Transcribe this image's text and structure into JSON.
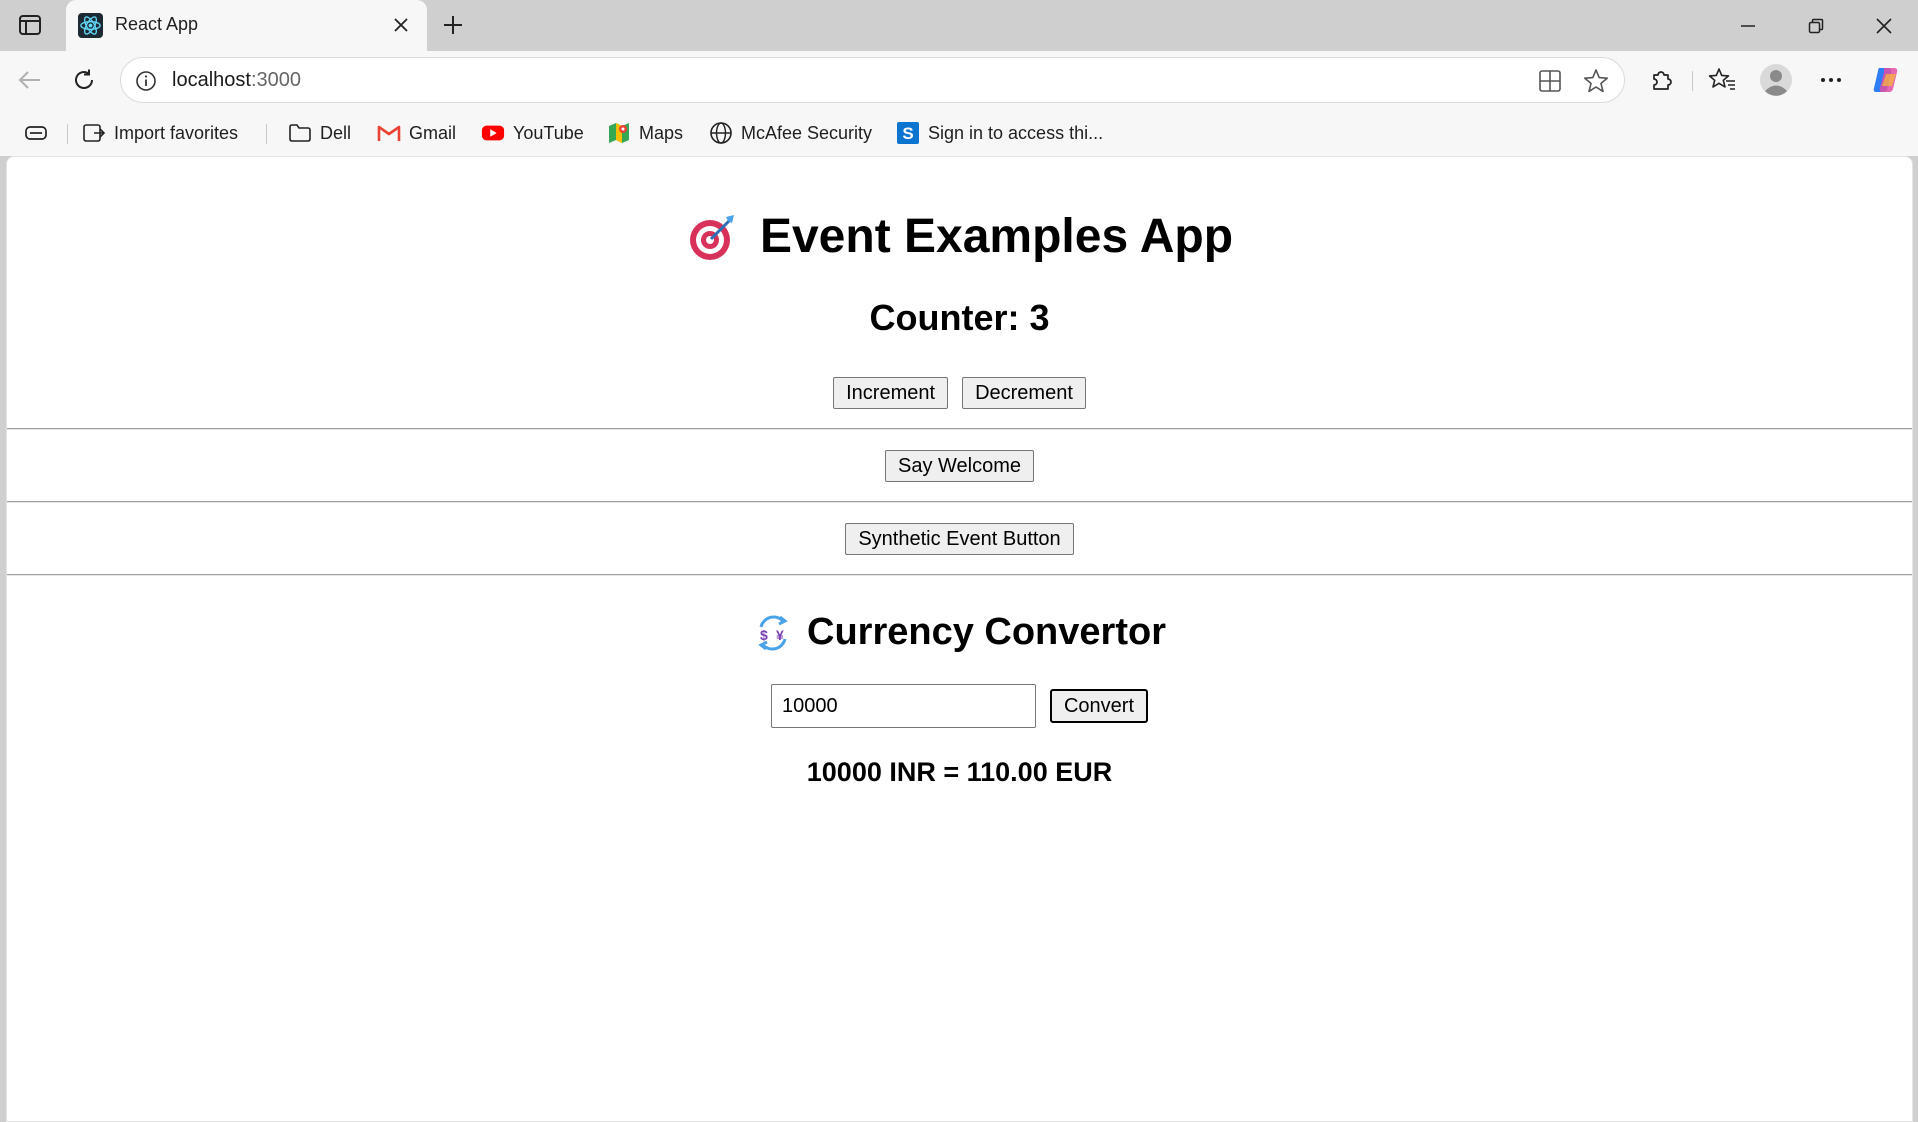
{
  "browser": {
    "tab": {
      "title": "React App"
    },
    "address": {
      "host": "localhost",
      "port": ":3000"
    },
    "favorites": [
      {
        "label": "Import favorites",
        "icon": "import-icon"
      },
      {
        "label": "Dell",
        "icon": "folder-icon"
      },
      {
        "label": "Gmail",
        "icon": "gmail-icon"
      },
      {
        "label": "YouTube",
        "icon": "youtube-icon"
      },
      {
        "label": "Maps",
        "icon": "maps-icon"
      },
      {
        "label": "McAfee Security",
        "icon": "globe-icon"
      },
      {
        "label": "Sign in to access thi...",
        "icon": "s-icon"
      }
    ],
    "colors": {
      "youtube": "#ff0000",
      "s_badge": "#0a74d0",
      "gmail": "#ea4335"
    }
  },
  "app": {
    "title": "Event Examples App",
    "title_emoji": "target-icon",
    "counter_label": "Counter: 3",
    "increment_label": "Increment",
    "decrement_label": "Decrement",
    "welcome_label": "Say Welcome",
    "synthetic_label": "Synthetic Event Button",
    "converter": {
      "title": "Currency Convertor",
      "title_emoji": "currency-exchange-icon",
      "amount_value": "10000",
      "convert_label": "Convert",
      "result": "10000 INR = 110.00 EUR"
    }
  }
}
